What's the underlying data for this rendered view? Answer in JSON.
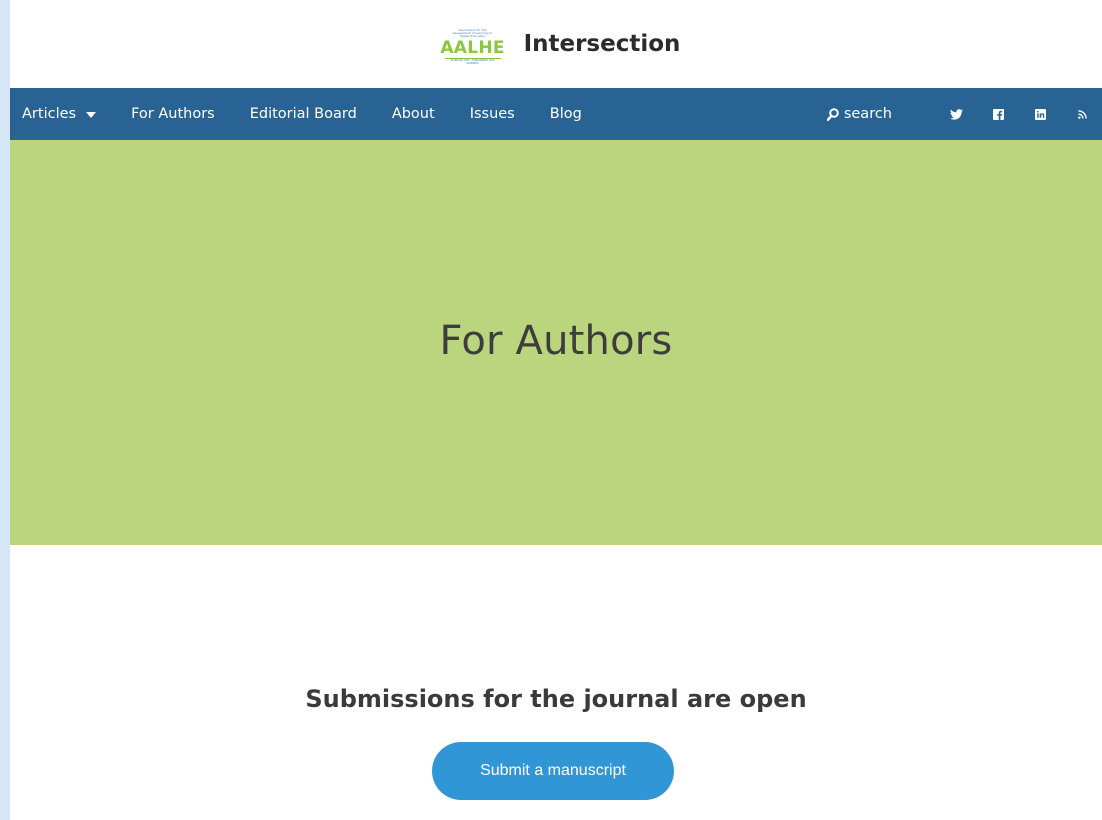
{
  "header": {
    "logo": {
      "wordmark": "AALHE",
      "fine_print": "Association for the Assessment of Learning in Higher Education",
      "tagline": "INTERSECTION · ASSESSMENT FOR LEARNING"
    },
    "site_title": "Intersection"
  },
  "nav": {
    "items": [
      {
        "label": "Articles",
        "has_dropdown": true
      },
      {
        "label": "For Authors"
      },
      {
        "label": "Editorial Board"
      },
      {
        "label": "About"
      },
      {
        "label": "Issues"
      },
      {
        "label": "Blog"
      }
    ],
    "search_label": "search",
    "social_icons": [
      "twitter-icon",
      "facebook-icon",
      "linkedin-icon",
      "rss-icon"
    ]
  },
  "hero": {
    "title": "For Authors"
  },
  "content": {
    "heading": "Submissions for the journal are open",
    "button_label": "Submit a manuscript"
  },
  "colors": {
    "nav_bg": "#286393",
    "hero_bg": "#bbd57f",
    "button_bg": "#3196d6",
    "logo_green": "#8cc63f",
    "page_frame": "#d5e6f6"
  }
}
